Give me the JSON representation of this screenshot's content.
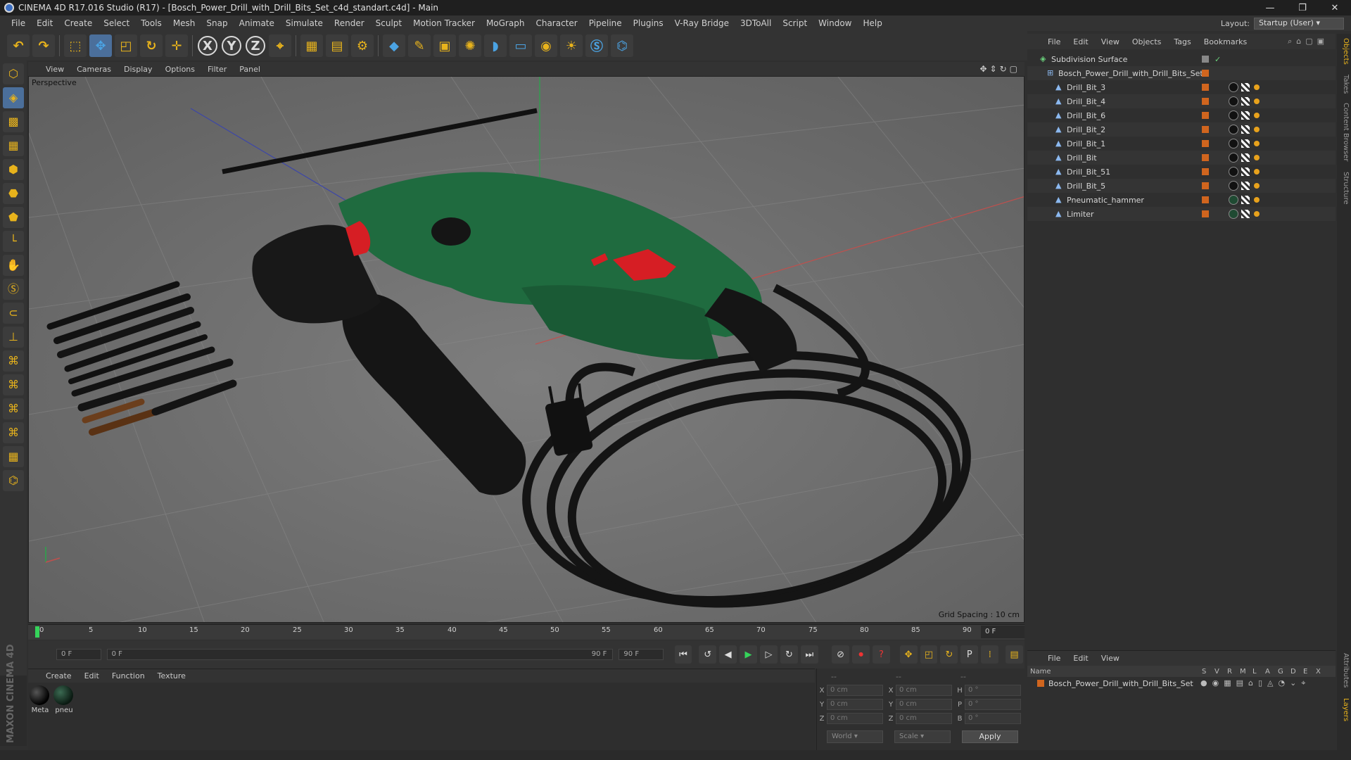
{
  "window": {
    "title": "CINEMA 4D R17.016 Studio (R17) - [Bosch_Power_Drill_with_Drill_Bits_Set_c4d_standart.c4d] - Main",
    "controls": [
      "—",
      "❐",
      "✕"
    ]
  },
  "menu": [
    "File",
    "Edit",
    "Create",
    "Select",
    "Tools",
    "Mesh",
    "Snap",
    "Animate",
    "Simulate",
    "Render",
    "Sculpt",
    "Motion Tracker",
    "MoGraph",
    "Character",
    "Pipeline",
    "Plugins",
    "V-Ray Bridge",
    "3DToAll",
    "Script",
    "Window",
    "Help"
  ],
  "layout": {
    "label": "Layout:",
    "value": "Startup (User)"
  },
  "toolbar_axes": [
    "X",
    "Y",
    "Z"
  ],
  "viewport": {
    "menu": [
      "View",
      "Cameras",
      "Display",
      "Options",
      "Filter",
      "Panel"
    ],
    "label": "Perspective",
    "grid_spacing": "Grid Spacing : 10 cm"
  },
  "timeline": {
    "ticks": [
      "0",
      "5",
      "10",
      "15",
      "20",
      "25",
      "30",
      "35",
      "40",
      "45",
      "50",
      "55",
      "60",
      "65",
      "70",
      "75",
      "80",
      "85",
      "90"
    ],
    "current_frame": "0 F"
  },
  "transport": {
    "start_field": "0 F",
    "range_start": "0 F",
    "range_end": "90 F",
    "end_field": "90 F"
  },
  "materials": {
    "menu": [
      "Create",
      "Edit",
      "Function",
      "Texture"
    ],
    "items": [
      {
        "name": "Meta"
      },
      {
        "name": "pneu"
      }
    ]
  },
  "brand": "MAXON CINEMA 4D",
  "coordinates": {
    "headers": [
      "--",
      "--",
      "--"
    ],
    "rows": [
      {
        "a": "X",
        "av": "0 cm",
        "b": "X",
        "bv": "0 cm",
        "c": "H",
        "cv": "0 °"
      },
      {
        "a": "Y",
        "av": "0 cm",
        "b": "Y",
        "bv": "0 cm",
        "c": "P",
        "cv": "0 °"
      },
      {
        "a": "Z",
        "av": "0 cm",
        "b": "Z",
        "bv": "0 cm",
        "c": "B",
        "cv": "0 °"
      }
    ],
    "mode": "World",
    "scale_mode": "Scale",
    "apply": "Apply"
  },
  "object_manager": {
    "menu": [
      "File",
      "Edit",
      "View",
      "Objects",
      "Tags",
      "Bookmarks"
    ],
    "objects": [
      {
        "name": "Subdivision Surface",
        "indent": 0
      },
      {
        "name": "Bosch_Power_Drill_with_Drill_Bits_Set",
        "indent": 1
      },
      {
        "name": "Drill_Bit_3",
        "indent": 2
      },
      {
        "name": "Drill_Bit_4",
        "indent": 2
      },
      {
        "name": "Drill_Bit_6",
        "indent": 2
      },
      {
        "name": "Drill_Bit_2",
        "indent": 2
      },
      {
        "name": "Drill_Bit_1",
        "indent": 2
      },
      {
        "name": "Drill_Bit",
        "indent": 2
      },
      {
        "name": "Drill_Bit_51",
        "indent": 2
      },
      {
        "name": "Drill_Bit_5",
        "indent": 2
      },
      {
        "name": "Pneumatic_hammer",
        "indent": 2
      },
      {
        "name": "Limiter",
        "indent": 2
      }
    ]
  },
  "side_tabs": [
    "Objects",
    "Takes",
    "Content Browser",
    "Structure",
    "Attributes",
    "Layers"
  ],
  "layer_manager": {
    "menu": [
      "File",
      "Edit",
      "View"
    ],
    "columns": [
      "Name",
      "S",
      "V",
      "R",
      "M",
      "L",
      "A",
      "G",
      "D",
      "E",
      "X"
    ],
    "row": "Bosch_Power_Drill_with_Drill_Bits_Set"
  },
  "colors": {
    "accent_orange": "#d0651e",
    "drill_green": "#1f6b3f",
    "drill_red": "#d61e24",
    "playhead": "#35d35a"
  }
}
